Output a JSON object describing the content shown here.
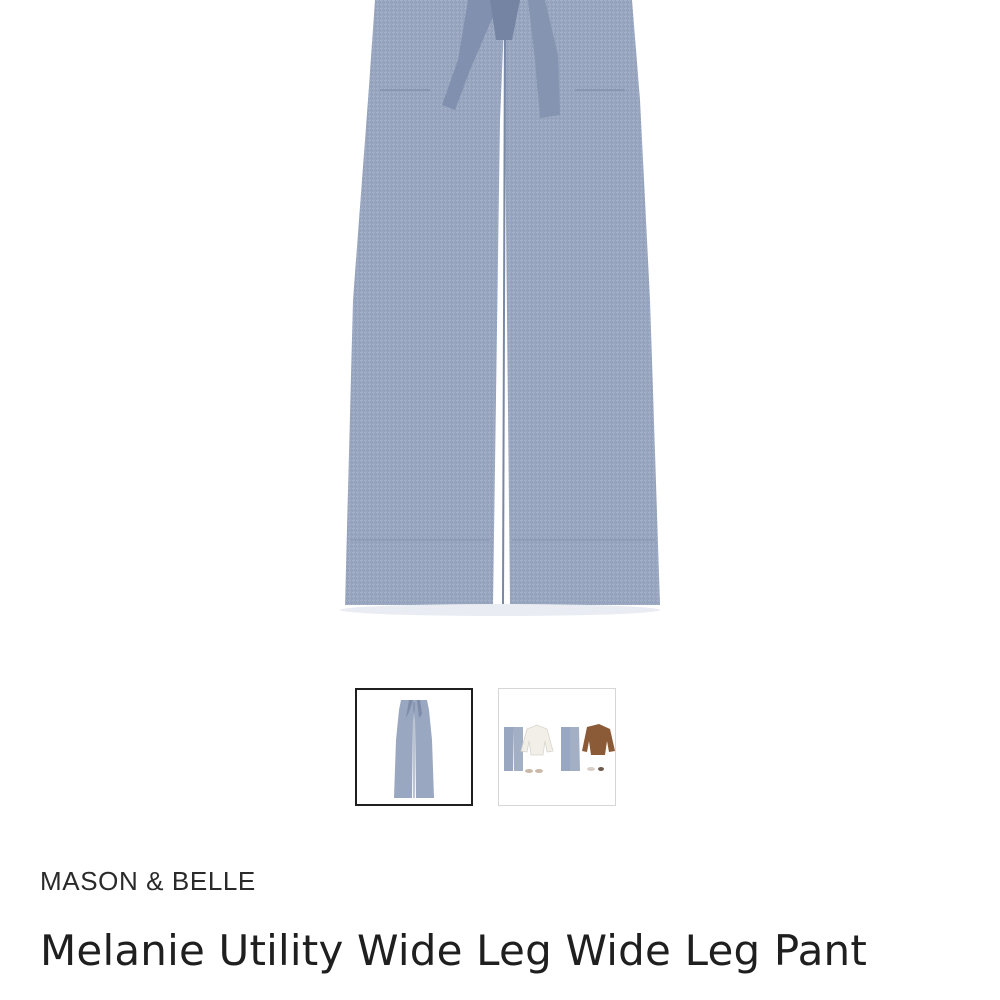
{
  "product": {
    "brand": "MASON & BELLE",
    "title": "Melanie Utility Wide Leg Wide Leg Pant"
  },
  "gallery": {
    "main_image": "wide-leg-pant-image",
    "thumbnails": [
      {
        "name": "pant-front-thumbnail",
        "selected": true
      },
      {
        "name": "outfit-styling-thumbnail",
        "selected": false
      }
    ]
  },
  "colors": {
    "fabric": "#98a6c0",
    "fabric_dark": "#7d8ca9",
    "text": "#1f1f1f"
  }
}
